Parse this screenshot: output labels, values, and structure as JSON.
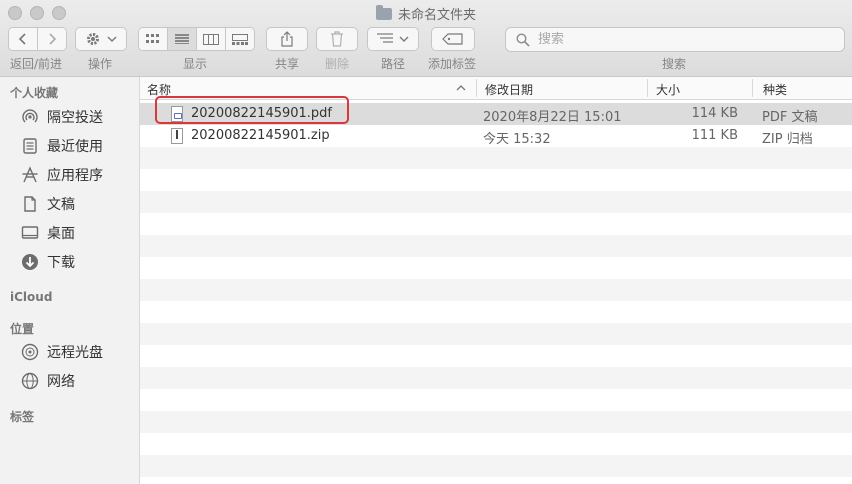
{
  "window": {
    "title": "未命名文件夹"
  },
  "toolbar": {
    "nav_label": "返回/前进",
    "action_label": "操作",
    "view_label": "显示",
    "share_label": "共享",
    "delete_label": "删除",
    "path_label": "路径",
    "tags_label": "添加标签",
    "search_label": "搜索",
    "search_placeholder": "搜索"
  },
  "sidebar": {
    "favorites_title": "个人收藏",
    "favorites": [
      {
        "label": "隔空投送",
        "icon": "airdrop-icon"
      },
      {
        "label": "最近使用",
        "icon": "recents-icon"
      },
      {
        "label": "应用程序",
        "icon": "applications-icon"
      },
      {
        "label": "文稿",
        "icon": "documents-icon"
      },
      {
        "label": "桌面",
        "icon": "desktop-icon"
      },
      {
        "label": "下载",
        "icon": "downloads-icon"
      }
    ],
    "icloud_title": "iCloud",
    "locations_title": "位置",
    "locations": [
      {
        "label": "远程光盘",
        "icon": "remote-disc-icon"
      },
      {
        "label": "网络",
        "icon": "network-icon"
      }
    ],
    "tags_title": "标签"
  },
  "list": {
    "columns": {
      "name": "名称",
      "modified": "修改日期",
      "size": "大小",
      "kind": "种类"
    },
    "rows": [
      {
        "name": "20200822145901.pdf",
        "modified": "2020年8月22日 15:01",
        "size": "114 KB",
        "kind": "PDF 文稿",
        "icon": "pdf-file-icon",
        "selected": true
      },
      {
        "name": "20200822145901.zip",
        "modified": "今天 15:32",
        "size": "111 KB",
        "kind": "ZIP 归档",
        "icon": "zip-file-icon",
        "selected": false
      }
    ]
  },
  "colors": {
    "highlight_border": "#d9363e",
    "selected_row": "#dcdcdc"
  }
}
